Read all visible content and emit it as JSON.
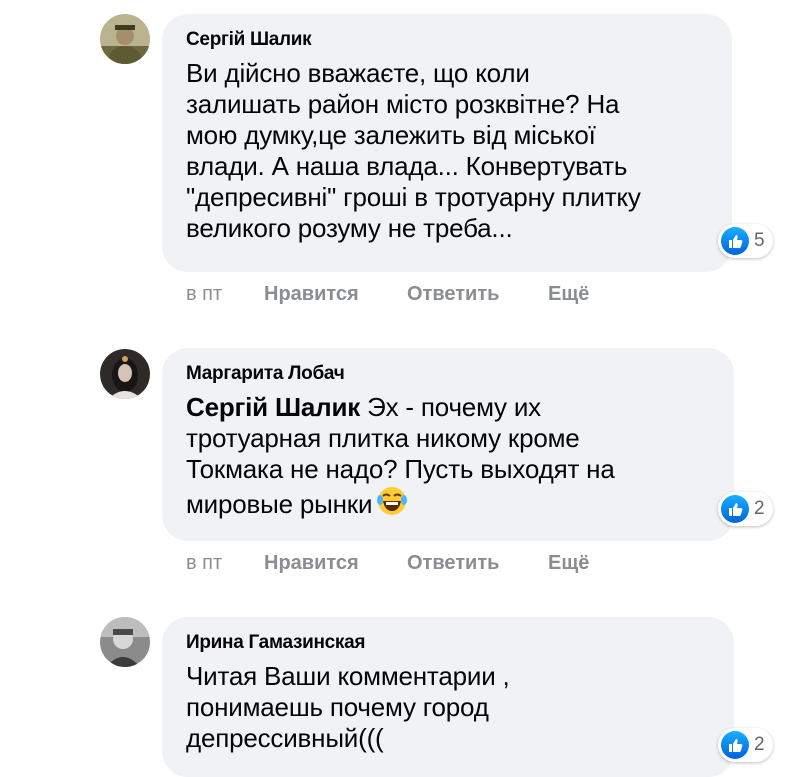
{
  "comments": [
    {
      "author": "Сергій Шалик",
      "avatar_icon": "man-photo-avatar",
      "lines": [
        "Ви дійсно вважаєте, що коли",
        "залишать район місто розквітне? На",
        "мою думку,це залежить від міської",
        "влади. А наша влада... Конвертувать",
        "\"депресивні\" гроші в тротуарну плитку",
        "великого розуму не треба..."
      ],
      "reaction_icon": "like-icon",
      "reaction_count": "5",
      "time": "в пт",
      "like_label": "Нравится",
      "reply_label": "Ответить",
      "more_label": "Ещё"
    },
    {
      "author": "Маргарита Лобач",
      "avatar_icon": "woman-photo-avatar",
      "mention": "Сергій Шалик",
      "lines": [
        " Эх - почему их",
        "тротуарная плитка никому кроме",
        "Токмака не надо? Пусть выходят на",
        "мировые рынки"
      ],
      "emoji_icon": "laughing-tears-emoji",
      "reaction_icon": "like-icon",
      "reaction_count": "2",
      "time": "в пт",
      "like_label": "Нравится",
      "reply_label": "Ответить",
      "more_label": "Ещё"
    },
    {
      "author": "Ирина Гамазинская",
      "avatar_icon": "child-photo-avatar",
      "lines": [
        "Читая Ваши комментарии ,",
        "понимаешь почему город",
        "депрессивный((("
      ],
      "reaction_icon": "like-icon",
      "reaction_count": "2"
    }
  ],
  "colors": {
    "bubble": "#f0f2f5",
    "text": "#050505",
    "muted": "#8a8d91",
    "like_blue": "#0866ff"
  }
}
